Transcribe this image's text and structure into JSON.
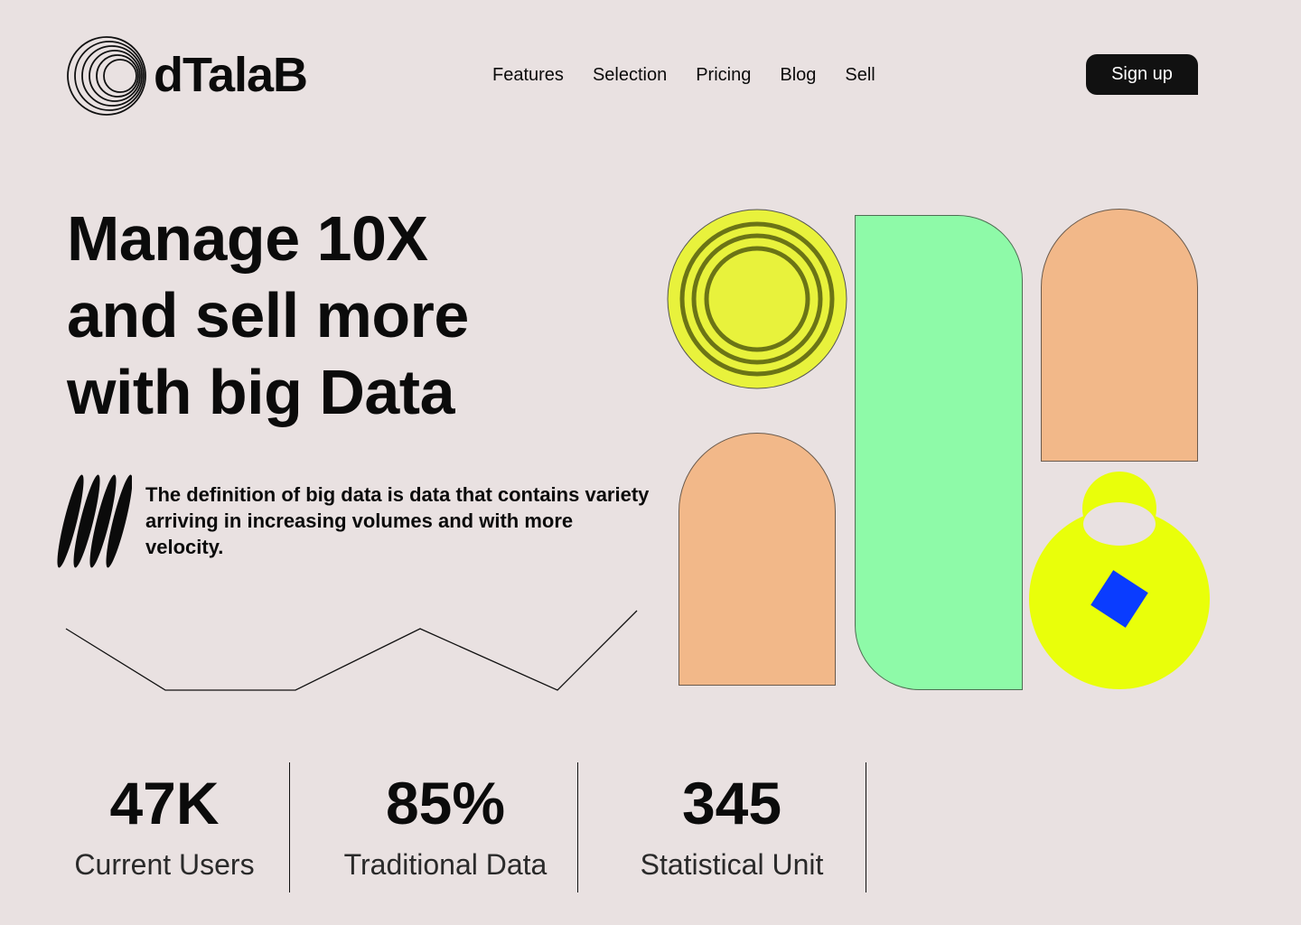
{
  "header": {
    "brand": "dTalaB",
    "nav": [
      "Features",
      "Selection",
      "Pricing",
      "Blog",
      "Sell"
    ],
    "signup_label": "Sign up"
  },
  "hero": {
    "title_lines": [
      "Manage 10X",
      "and sell more",
      "with big Data"
    ],
    "description": "The definition of big data is data that contains variety arriving in increasing volumes and  with more velocity."
  },
  "stats": [
    {
      "value": "47K",
      "label": "Current Users"
    },
    {
      "value": "85%",
      "label": "Traditional Data"
    },
    {
      "value": "345",
      "label": "Statistical Unit"
    }
  ],
  "colors": {
    "background": "#e9e1e1",
    "ink": "#0b0b0b",
    "yellow": "#e8f23c",
    "lime": "#e9ff0a",
    "green": "#8efaa8",
    "peach": "#f2b889",
    "blue": "#0a3cff"
  },
  "icons": {
    "logo": "concentric-rings-logo-icon",
    "stripes": "diagonal-stripes-icon"
  }
}
